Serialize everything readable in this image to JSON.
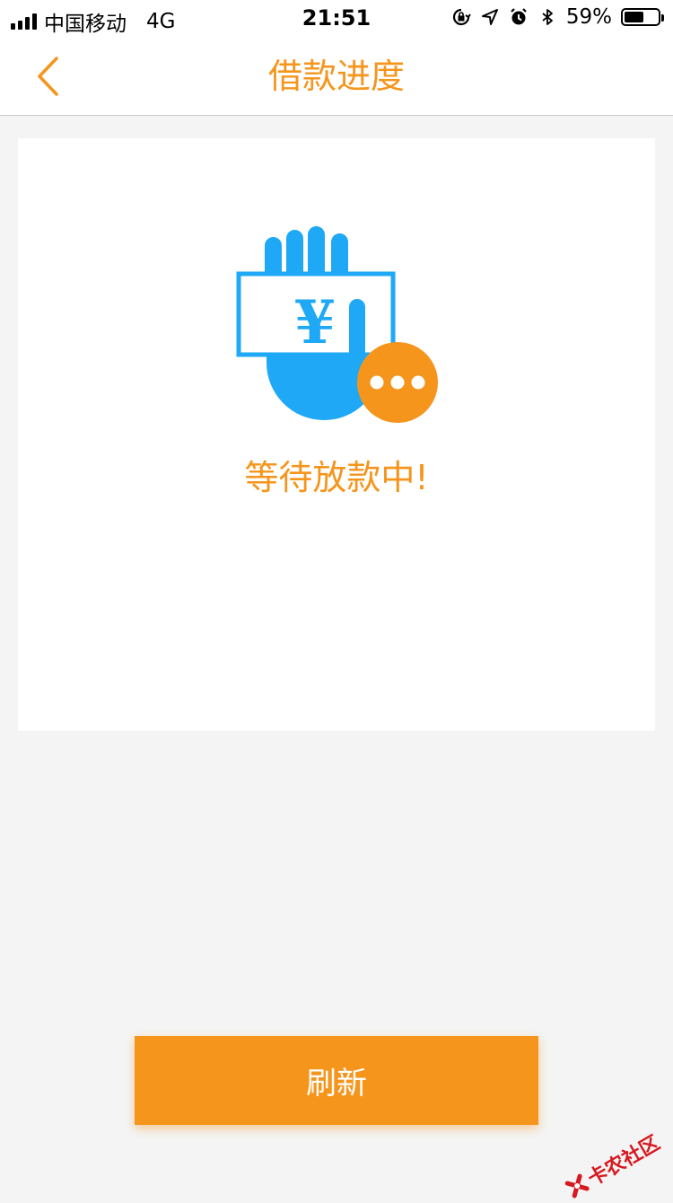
{
  "status_bar": {
    "carrier": "中国移动",
    "network": "4G",
    "time": "21:51",
    "battery_percent": "59%",
    "battery_level": 0.59,
    "icons": [
      "signal-icon",
      "orientation-lock-icon",
      "location-icon",
      "alarm-icon",
      "bluetooth-icon",
      "battery-icon"
    ]
  },
  "nav": {
    "title": "借款进度",
    "back_icon": "chevron-left-icon"
  },
  "card": {
    "illustration": "hand-holding-yuan-note-icon",
    "status_text": "等待放款中!"
  },
  "refresh_label": "刷新",
  "watermark": {
    "text": "卡农社区"
  },
  "colors": {
    "accent": "#f5951c",
    "illustration_blue": "#1ea8f5",
    "background": "#f4f4f4"
  }
}
